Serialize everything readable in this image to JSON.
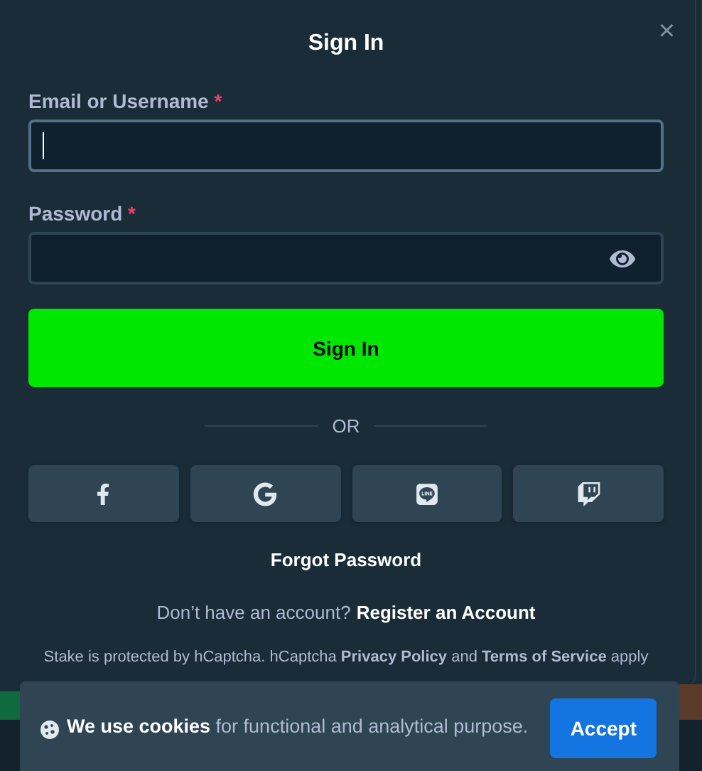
{
  "dialog": {
    "title": "Sign In",
    "close": "×"
  },
  "fields": [
    {
      "label": "Email or Username",
      "required_mark": "*",
      "kind": "text",
      "focused": true
    },
    {
      "label": "Password",
      "required_mark": "*",
      "kind": "password",
      "focused": false
    }
  ],
  "submit": "Sign In",
  "divider": "OR",
  "social_buttons": [
    {
      "kind": "facebook"
    },
    {
      "kind": "google"
    },
    {
      "kind": "line"
    },
    {
      "kind": "twitch"
    }
  ],
  "forgot": "Forgot Password",
  "register": {
    "prompt": "Don’t have an account?",
    "link": "Register an Account"
  },
  "captcha_note": "Stake is protected by hCaptcha. hCaptcha **Privacy Policy** and **Terms of Service** apply",
  "cookie_banner": {
    "text": "**We use cookies** for functional and analytical purpose.",
    "button": "Accept"
  }
}
